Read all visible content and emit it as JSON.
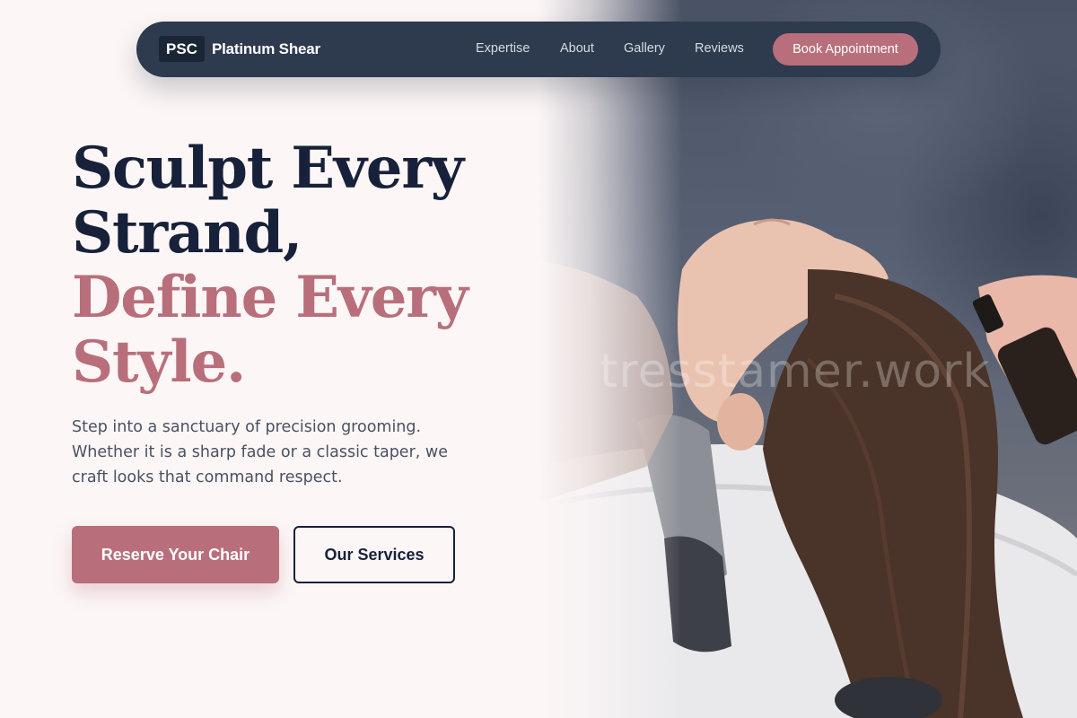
{
  "nav": {
    "logo_mark": "PSC",
    "brand_name": "Platinum Shear",
    "links": [
      "Expertise",
      "About",
      "Gallery",
      "Reviews"
    ],
    "cta_label": "Book Appointment"
  },
  "hero": {
    "headline_line1": "Sculpt Every",
    "headline_line2": "Strand,",
    "headline_line3": "Define Every",
    "headline_line4": "Style.",
    "description": "Step into a sanctuary of precision grooming. Whether it is a sharp fade or a classic taper, we craft looks that command respect.",
    "primary_button": "Reserve Your Chair",
    "secondary_button": "Our Services",
    "photo_watermark": "tresstamer.work"
  },
  "colors": {
    "background": "#fcf6f6",
    "nav_background": "#2e3a4e",
    "accent": "#b86f7b",
    "heading": "#17213a",
    "body_text": "#4a5164"
  }
}
